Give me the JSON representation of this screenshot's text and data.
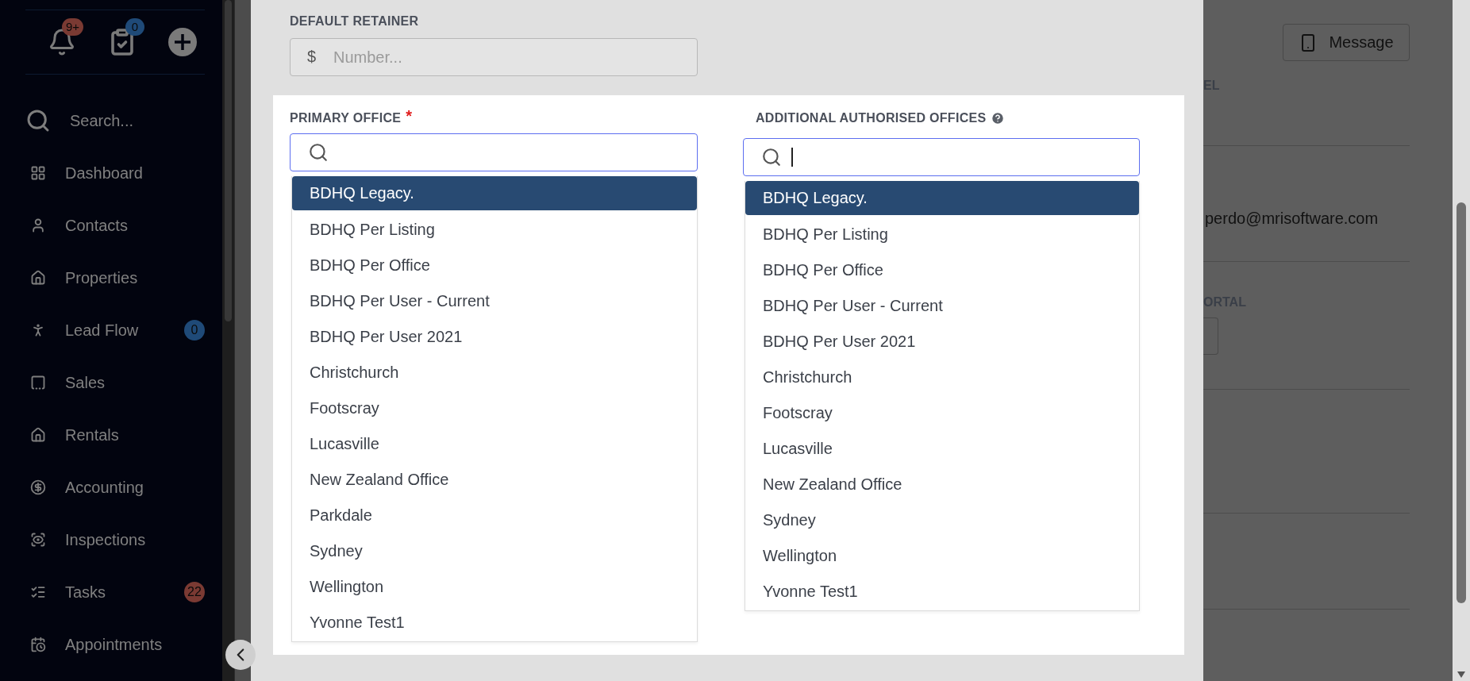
{
  "sidebar": {
    "notifications_badge": "9+",
    "tasks_badge": "0",
    "search": {
      "placeholder": "Search..."
    },
    "items": [
      {
        "label": "Dashboard"
      },
      {
        "label": "Contacts"
      },
      {
        "label": "Properties"
      },
      {
        "label": "Lead Flow",
        "badge": {
          "text": "0",
          "color": "#1f4a78"
        }
      },
      {
        "label": "Sales"
      },
      {
        "label": "Rentals"
      },
      {
        "label": "Accounting"
      },
      {
        "label": "Inspections"
      },
      {
        "label": "Tasks",
        "badge": {
          "text": "22",
          "color": "#7a3a33"
        }
      },
      {
        "label": "Appointments"
      }
    ]
  },
  "modal": {
    "default_retainer": {
      "label": "DEFAULT RETAINER",
      "prefix": "$",
      "placeholder": "Number..."
    },
    "primary_office": {
      "label": "PRIMARY OFFICE",
      "required_mark": "*",
      "options": [
        {
          "label": "BDHQ Legacy.",
          "selected": true
        },
        {
          "label": "BDHQ Per Listing",
          "selected": false
        },
        {
          "label": "BDHQ Per Office",
          "selected": false
        },
        {
          "label": "BDHQ Per User - Current",
          "selected": false
        },
        {
          "label": "BDHQ Per User 2021",
          "selected": false
        },
        {
          "label": "Christchurch",
          "selected": false
        },
        {
          "label": "Footscray",
          "selected": false
        },
        {
          "label": "Lucasville",
          "selected": false
        },
        {
          "label": "New Zealand Office",
          "selected": false
        },
        {
          "label": "Parkdale",
          "selected": false
        },
        {
          "label": "Sydney",
          "selected": false
        },
        {
          "label": "Wellington",
          "selected": false
        },
        {
          "label": "Yvonne Test1",
          "selected": false
        }
      ]
    },
    "additional_offices": {
      "label": "ADDITIONAL AUTHORISED OFFICES",
      "options": [
        {
          "label": "BDHQ Legacy.",
          "selected": true
        },
        {
          "label": "BDHQ Per Listing",
          "selected": false
        },
        {
          "label": "BDHQ Per Office",
          "selected": false
        },
        {
          "label": "BDHQ Per User - Current",
          "selected": false
        },
        {
          "label": "BDHQ Per User 2021",
          "selected": false
        },
        {
          "label": "Christchurch",
          "selected": false
        },
        {
          "label": "Footscray",
          "selected": false
        },
        {
          "label": "Lucasville",
          "selected": false
        },
        {
          "label": "New Zealand Office",
          "selected": false
        },
        {
          "label": "Sydney",
          "selected": false
        },
        {
          "label": "Wellington",
          "selected": false
        },
        {
          "label": "Yvonne Test1",
          "selected": false
        }
      ]
    }
  },
  "background": {
    "message_button": "Message",
    "label_1": "EL",
    "email": "perdo@mrisoftware.com",
    "label_2": "ORTAL"
  }
}
